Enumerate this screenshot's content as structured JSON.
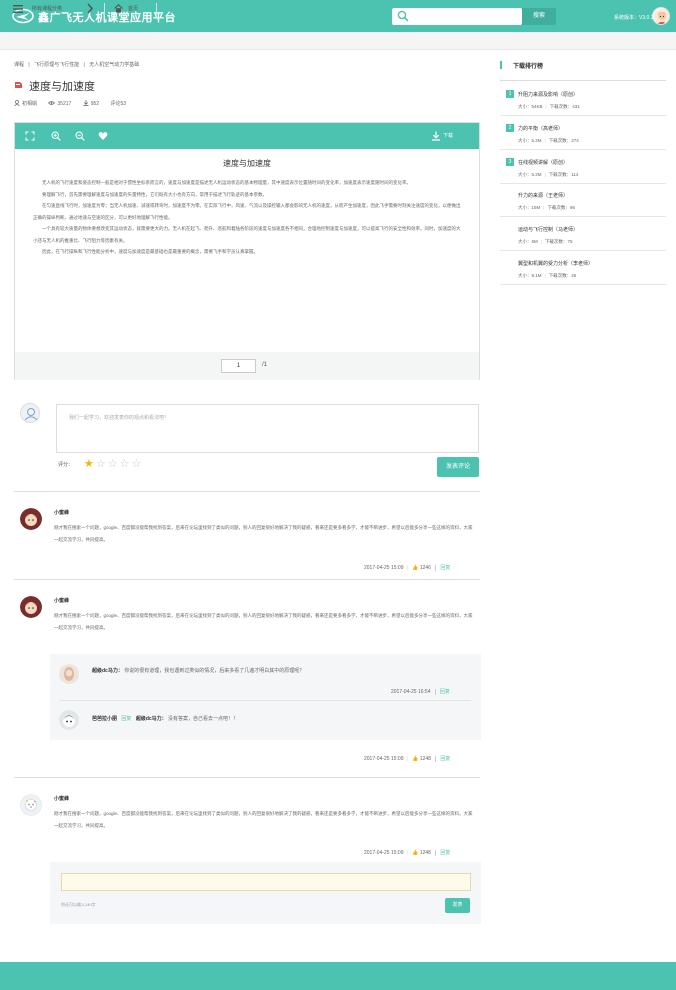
{
  "header": {
    "brand": "鑫广飞无人机课堂应用平台",
    "search_button": "搜索"
  },
  "subnav": {
    "all_courses": "所有课程分类",
    "home": "首页"
  },
  "breadcrumb": [
    "课程",
    "|",
    "飞行原理与飞行性能",
    "|",
    "无人机空气动力学基础"
  ],
  "page_title": "速度与加速度",
  "meta": {
    "author": "初相娟",
    "views": "35217",
    "downloads": "952",
    "comments": "评论53"
  },
  "viewer": {
    "download_label": "下载",
    "doc_title": "速度与加速度",
    "paragraphs": [
      "无人机的飞行速度和姿态控制一般是相对于惯性坐标系而言的，速度与加速度是描述无人机运动状态的基本物理量，其中速度表示位置随时间的变化率，加速度表示速度随时间的变化率。",
      "要理解飞行，首先需要理解速度与加速度的矢量特性，它们既有大小也有方向，常用于描述飞行轨迹的基本参数。",
      "在匀速直线飞行时，加速度为零；当无人机加速、减速或转弯时，加速度不为零。在实际飞行中，风速、气流以及操控输入都会影响无人机的速度，从而产生加速度，因此飞手需要时刻关注速度的变化，以便做出正确的操纵判断。通过地速与空速的区分，可以更好地理解飞行性能。",
      "一个具有较大质量的物体要想改变其运动状态，就需要更大的力。无人机在起飞、爬升、巡航和着陆各阶段的速度与加速度各不相同，合理地控制速度与加速度，可以提高飞行的安全性和效率。同时，加速度的大小还与无人机的推重比、飞行阻力等因素有关。",
      "因此，在飞行操纵和飞行性能分析中，速度与加速度是最基础也是最重要的概念，需要飞手和学员认真掌握。"
    ],
    "page_current": "1",
    "page_total": "/1"
  },
  "comment_form": {
    "placeholder": "我们一起学习，欢迎发表你的观点和看法吧！",
    "rating_label": "评分：",
    "stars": [
      "★",
      "☆",
      "☆",
      "☆",
      "☆"
    ],
    "submit": "发表评论"
  },
  "comments": [
    {
      "name": "小蜜蜂",
      "text": "刚才我在搜索一个问题，google、百度都没能帮我找到答案，后来在论坛里找到了类似的问题，别人的回复很好地解决了我的疑惑，看来还是要多看多学，才能不断进步，希望以后能多分享一些这样的资料，大家一起交流学习，共同提高。",
      "date": "2017-04-25",
      "time": "15:09",
      "likes": "1246",
      "reply": "回复"
    },
    {
      "name": "小蜜蜂",
      "text": "刚才我在搜索一个问题，google、百度都没能帮我找到答案，后来在论坛里找到了类似的问题，别人的回复很好地解决了我的疑惑，看来还是要多看多学，才能不断进步，希望以后能多分享一些这样的资料，大家一起交流学习，共同提高。",
      "date": "2017-04-25",
      "time": "15:09",
      "likes": "1248",
      "reply": "回复",
      "replies": [
        {
          "name": "超级dc马力：",
          "text": "你说的很有道理，我也遇到过类似的情况，后来多看了几遍才明白其中的原理呢？",
          "date": "2017-04-25",
          "time": "16:54",
          "reply": "回复"
        },
        {
          "name": "芭芭拉小朋",
          "action": "回复",
          "target": "超级dc马力：",
          "text": "没有答案，自己看去一点吧！！"
        }
      ]
    },
    {
      "name": "小蜜蜂",
      "text": "刚才我在搜索一个问题，google、百度都没能帮我找到答案，后来在论坛里找到了类似的问题，别人的回复很好地解决了我的疑惑，看来还是要多看多学，才能不断进步，希望以后能多分享一些这样的资料，大家一起交流学习，共同提高。",
      "date": "2017-04-25",
      "time": "15:09",
      "likes": "1248",
      "reply": "回复"
    }
  ],
  "reply_box": {
    "count_hint": "你还可以输入140字",
    "send": "发表"
  },
  "sidebar": {
    "title": "下载排行榜",
    "size_label": "大小：",
    "count_label": "下载次数：",
    "items": [
      {
        "rank": "1",
        "name": "升阻力来源及影响（原创）",
        "size": "54KB",
        "count": "431"
      },
      {
        "rank": "2",
        "name": "力的平衡（高老师）",
        "size": "5.2M",
        "count": "274"
      },
      {
        "rank": "3",
        "name": "在线视频讲解（原创）",
        "size": "5.2M",
        "count": "114"
      },
      {
        "rank": "",
        "name": "升力的来源（王老师）",
        "size": "15M",
        "count": "96"
      },
      {
        "rank": "",
        "name": "运动与飞行控制（马老师）",
        "size": "6M",
        "count": "75"
      },
      {
        "rank": "",
        "name": "翼型和机翼的受力分析（李老师）",
        "size": "8.1M",
        "count": "26"
      }
    ]
  },
  "footer": {
    "version": "系统版本：V3.0.1"
  },
  "colors": {
    "brand": "#4cc3b0",
    "like": "#dd3333",
    "star": "#f5b400"
  }
}
